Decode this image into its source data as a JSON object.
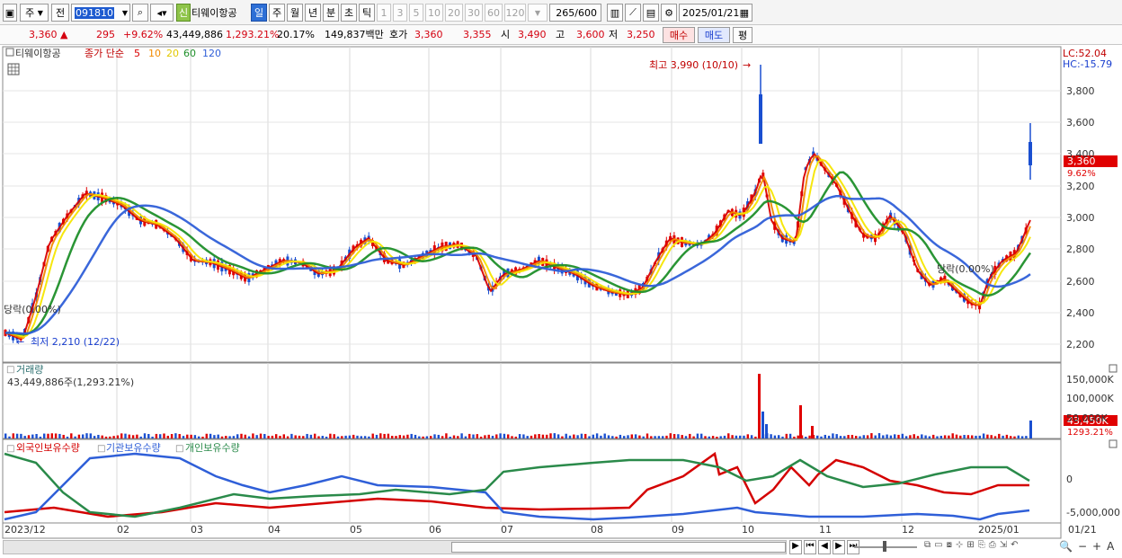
{
  "toolbar": {
    "market_type": "주",
    "prev_label": "전",
    "stock_code": "091810",
    "credit_badge": "신",
    "stock_name": "티웨이항공",
    "periods": [
      "일",
      "주",
      "월",
      "년",
      "분",
      "초",
      "틱"
    ],
    "active_period": "일",
    "intervals": [
      "1",
      "3",
      "5",
      "10",
      "20",
      "30",
      "60",
      "120"
    ],
    "count_value": "265",
    "count_max": "/600",
    "date": "2025/01/21"
  },
  "quote": {
    "price": "3,360",
    "arrow": "▲",
    "change": "295",
    "change_pct": "+9.62%",
    "volume": "43,449,886",
    "volume_pct": "1,293.21%",
    "turnover": "20.17%",
    "amount": "149,837백만",
    "bid_label": "호가",
    "bid1": "3,360",
    "bid2": "3,355",
    "open_label": "시",
    "open": "3,490",
    "high_label": "고",
    "high": "3,600",
    "low_label": "저",
    "low": "3,250",
    "buy_button": "매수",
    "sell_button": "매도",
    "avg_button": "평"
  },
  "price_pane": {
    "legend_name": "티웨이항공",
    "legend_ma": "종가 단순",
    "ma_periods": [
      "5",
      "10",
      "20",
      "60",
      "120"
    ],
    "ma_colors": [
      "#d90000",
      "#f28a00",
      "#f5e600",
      "#1f8f2a",
      "#2f5fd8"
    ],
    "lc": "LC:52.04",
    "hc": "HC:-15.79",
    "y_ticks": [
      "3,800",
      "3,600",
      "3,400",
      "3,200",
      "3,000",
      "2,800",
      "2,600",
      "2,400",
      "2,200"
    ],
    "high_annotation": "최고 3,990 (10/10)",
    "low_annotation": "최저 2,210 (12/22)",
    "label_left": "당락(0.00%)",
    "label_right": "당락(0.00%)",
    "price_tag": "3,360",
    "price_tag_pct": "9.62%"
  },
  "volume_pane": {
    "title": "거래량",
    "value_text": "43,449,886주(1,293.21%)",
    "y_ticks": [
      "150,000K",
      "100,000K",
      "50,000K"
    ],
    "tag": "43,450K",
    "tag_pct": "1293.21%"
  },
  "holding_pane": {
    "series_names": [
      "외국인보유수량",
      "기관보유수량",
      "개인보유수량"
    ],
    "series_colors": [
      "#d40000",
      "#2f5fd8",
      "#2a8a4a"
    ],
    "y_ticks": [
      "0",
      "-5,000,000"
    ]
  },
  "x_axis": [
    "2023/12",
    "02",
    "03",
    "04",
    "05",
    "06",
    "07",
    "08",
    "09",
    "10",
    "11",
    "12",
    "2025/01",
    "01/21"
  ],
  "bottom_controls": [
    "▶",
    "⏮",
    "◀",
    "▶",
    "⏭",
    "🔍",
    "−",
    "+",
    "A"
  ]
}
